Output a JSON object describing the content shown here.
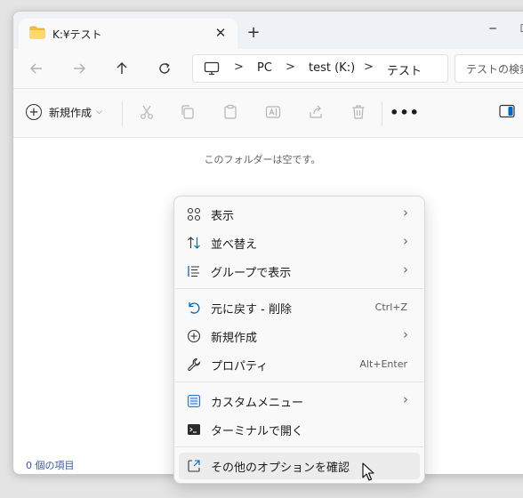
{
  "tab": {
    "title": "K:¥テスト",
    "folder_color": "#f3c13a"
  },
  "window_controls": {
    "minimize": "─",
    "maximize": "☐"
  },
  "new_tab": "+",
  "breadcrumb": {
    "items": [
      "PC",
      "test (K:)",
      "テスト"
    ],
    "separator": ">"
  },
  "search": {
    "placeholder": "テストの検索"
  },
  "toolbar": {
    "new_label": "新規作成",
    "more": "•••"
  },
  "content": {
    "empty_message": "このフォルダーは空です。"
  },
  "status_bar": {
    "text": "0 個の項目"
  },
  "context_menu": {
    "items": [
      {
        "label": "表示",
        "icon": "grid-icon",
        "submenu": true
      },
      {
        "label": "並べ替え",
        "icon": "sort-icon",
        "submenu": true
      },
      {
        "label": "グループで表示",
        "icon": "group-icon",
        "submenu": true
      },
      {
        "label": "元に戻す - 削除",
        "icon": "undo-icon",
        "shortcut": "Ctrl+Z"
      },
      {
        "label": "新規作成",
        "icon": "new-icon",
        "submenu": true
      },
      {
        "label": "プロパティ",
        "icon": "wrench-icon",
        "shortcut": "Alt+Enter"
      },
      {
        "label": "カスタムメニュー",
        "icon": "custom-menu-icon",
        "submenu": true
      },
      {
        "label": "ターミナルで開く",
        "icon": "terminal-icon"
      },
      {
        "label": "その他のオプションを確認",
        "icon": "more-options-icon"
      }
    ],
    "arrow": "›"
  },
  "colors": {
    "accent": "#0067c0",
    "status_text": "#3a57a8"
  }
}
